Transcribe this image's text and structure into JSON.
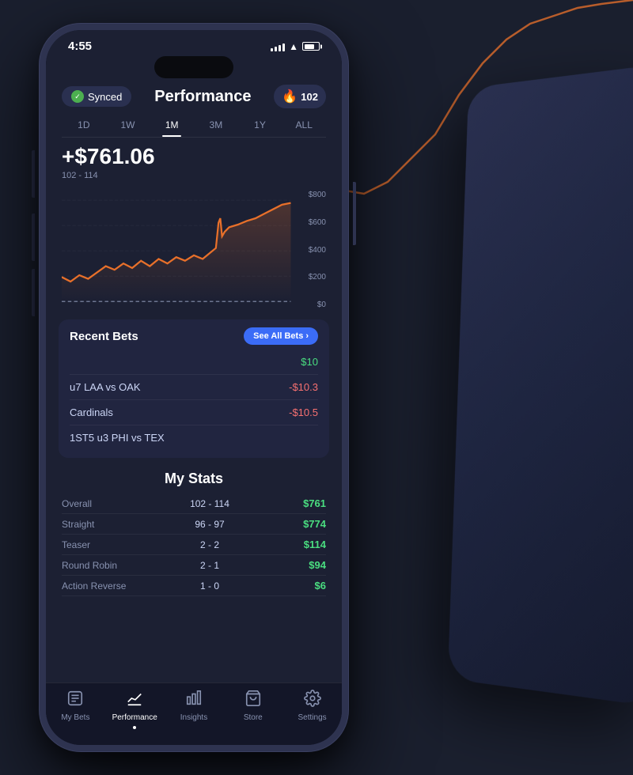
{
  "status_bar": {
    "time": "4:55",
    "signal": true,
    "wifi": true,
    "battery": 75
  },
  "header": {
    "synced_label": "Synced",
    "title": "Performance",
    "flame_count": "102"
  },
  "time_filters": [
    "1D",
    "1W",
    "1M",
    "3M",
    "1Y",
    "ALL"
  ],
  "active_filter": "1M",
  "performance": {
    "profit": "+$761.06",
    "range": "102 - 114"
  },
  "chart_labels": [
    "$800",
    "$600",
    "$400",
    "$200",
    "$0"
  ],
  "recent_bets": {
    "title": "Recent Bets",
    "see_all_label": "See All Bets",
    "bets": [
      {
        "name": "",
        "amount": "$10",
        "positive": true
      },
      {
        "name": "u7 LAA vs OAK",
        "amount": "-$10.3",
        "positive": false
      },
      {
        "name": "Cardinals",
        "amount": "-$10.5",
        "positive": false
      },
      {
        "name": "1ST5 u3 PHI vs TEX",
        "amount": "",
        "positive": true
      }
    ]
  },
  "my_stats": {
    "title": "My Stats",
    "stats": [
      {
        "label": "Overall",
        "record": "102 - 114",
        "value": "$761"
      },
      {
        "label": "Straight",
        "record": "96 - 97",
        "value": "$774"
      },
      {
        "label": "Teaser",
        "record": "2 - 2",
        "value": "$114"
      },
      {
        "label": "Round Robin",
        "record": "2 - 1",
        "value": "$94"
      },
      {
        "label": "Action Reverse",
        "record": "1 - 0",
        "value": "$6"
      }
    ]
  },
  "bottom_nav": [
    {
      "label": "My Bets",
      "icon": "📋",
      "active": false
    },
    {
      "label": "Performance",
      "icon": "📈",
      "active": true
    },
    {
      "label": "Insights",
      "icon": "📊",
      "active": false
    },
    {
      "label": "Store",
      "icon": "🛍",
      "active": false
    },
    {
      "label": "Settings",
      "icon": "⚙️",
      "active": false
    }
  ]
}
